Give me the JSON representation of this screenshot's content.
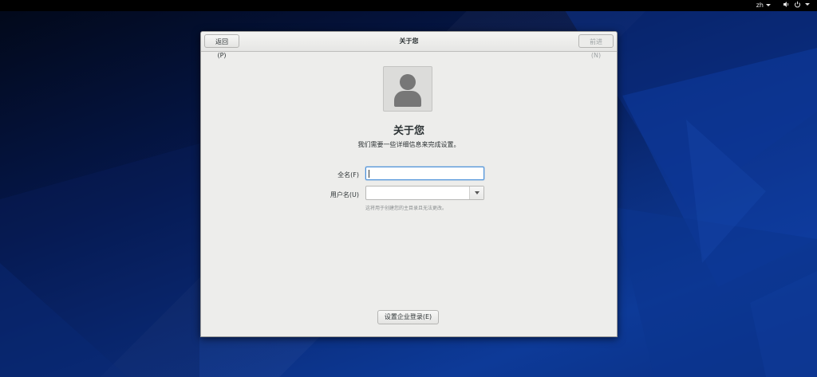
{
  "topbar": {
    "language": "zh",
    "icons": [
      "volume-icon",
      "power-icon"
    ]
  },
  "window": {
    "title": "关于您",
    "back_label": "返回(P)",
    "next_label": "前进(N)"
  },
  "page": {
    "heading": "关于您",
    "subtitle": "我们需要一些详细信息来完成设置。",
    "avatar_icon": "user-avatar-icon"
  },
  "form": {
    "fullname_label": "全名(F)",
    "fullname_value": "",
    "username_label": "用户名(U)",
    "username_value": "",
    "username_hint": "这将用于创建您的主目录且无法更改。"
  },
  "footer": {
    "enterprise_label": "设置企业登录(E)"
  },
  "colors": {
    "focus_border": "#4a90d9",
    "desktop_blue": "#0d3a98"
  }
}
